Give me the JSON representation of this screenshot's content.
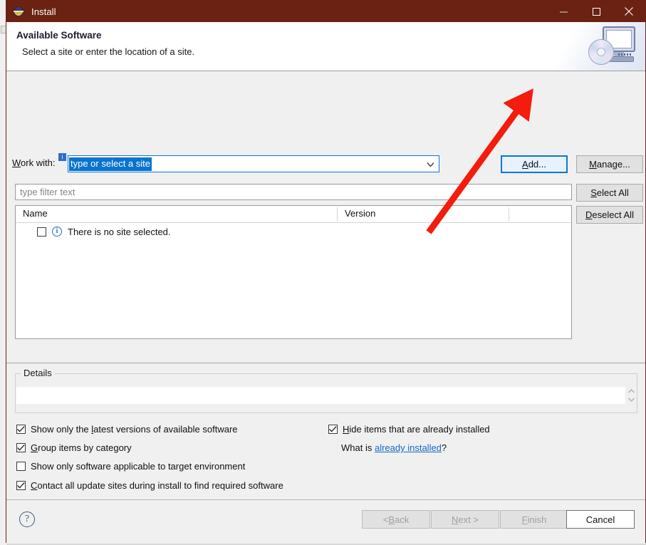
{
  "window": {
    "title": "Install",
    "icon": "eclipse-icon",
    "controls": {
      "minimize": "minimize-icon",
      "maximize": "maximize-icon",
      "close": "close-icon"
    }
  },
  "banner": {
    "title": "Available Software",
    "subtitle": "Select a site or enter the location of a site.",
    "icon": "install-monitor-disc-icon"
  },
  "work_with": {
    "label_prefix": "W",
    "label_rest": "ork with:",
    "badge": "i",
    "value": "type or select a site",
    "dropdown_icon": "chevron-down-icon"
  },
  "buttons": {
    "add": {
      "mnem": "A",
      "rest": "dd..."
    },
    "manage": {
      "mnem": "M",
      "rest": "anage..."
    },
    "select_all": {
      "pre": "",
      "mnem": "S",
      "rest": "elect All"
    },
    "deselect_all": {
      "pre": "",
      "mnem": "D",
      "rest": "eselect All"
    }
  },
  "filter": {
    "placeholder": "type filter text"
  },
  "table": {
    "columns": [
      "Name",
      "Version",
      ""
    ],
    "rows": [
      {
        "checked": false,
        "icon": "info-icon",
        "name": "There is no site selected.",
        "version": ""
      }
    ]
  },
  "details": {
    "legend": "Details",
    "content": "",
    "scroll_up_icon": "scroll-up-icon",
    "scroll_down_icon": "scroll-down-icon"
  },
  "options": [
    {
      "checked": true,
      "pre": "Show only the ",
      "mnem": "l",
      "rest": "atest versions of available software"
    },
    {
      "checked": true,
      "pre": "",
      "mnem": "G",
      "rest": "roup items by category"
    },
    {
      "checked": false,
      "pre": "",
      "mnem": "S",
      "rest": "how only software applicable to target environment"
    },
    {
      "checked": true,
      "pre": "",
      "mnem": "C",
      "rest": "ontact all update sites during install to find required software"
    },
    {
      "checked": true,
      "pre": "",
      "mnem": "H",
      "rest": "ide items that are already installed"
    }
  ],
  "what_is": {
    "prefix": "What is ",
    "link": "already installed",
    "suffix": "?"
  },
  "footer": {
    "help": "?",
    "back": {
      "pre": "< ",
      "mnem": "B",
      "rest": "ack",
      "enabled": false
    },
    "next": {
      "pre": "",
      "mnem": "N",
      "rest": "ext >",
      "enabled": false
    },
    "finish": {
      "pre": "",
      "mnem": "F",
      "rest": "inish",
      "enabled": false
    },
    "cancel": {
      "pre": "",
      "mnem": "",
      "rest": "Cancel",
      "enabled": true
    }
  },
  "annotation": {
    "type": "arrow",
    "color": "#f41c0c",
    "from": [
      602,
      326
    ],
    "to": [
      740,
      140
    ],
    "points_at": "add-button"
  },
  "colors": {
    "titlebar": "#6b2212",
    "accent_blue": "#0a76d6",
    "selection_blue": "#0a74cf",
    "link_blue": "#1569c7",
    "dialog_bg": "#f0f0f0",
    "arrow_red": "#f41c0c"
  }
}
